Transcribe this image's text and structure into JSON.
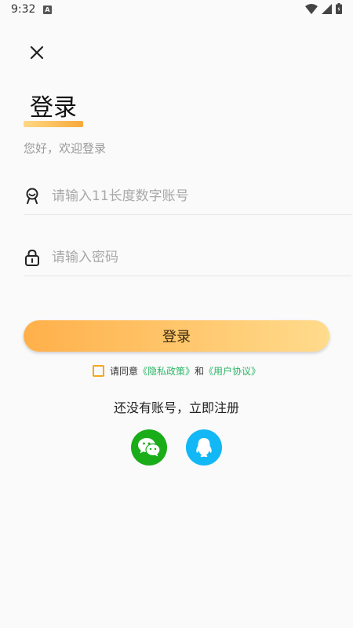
{
  "status_bar": {
    "time": "9:32",
    "notification_letter": "A",
    "icons": [
      "wifi-icon",
      "signal-icon",
      "battery-icon"
    ]
  },
  "header": {
    "close_icon": "close-icon"
  },
  "title": "登录",
  "subtitle": "您好，欢迎登录",
  "form": {
    "account": {
      "icon": "user-icon",
      "value": "",
      "placeholder": "请输入11长度数字账号"
    },
    "password": {
      "icon": "lock-icon",
      "value": "",
      "placeholder": "请输入密码"
    }
  },
  "login_button": "登录",
  "agreement": {
    "prefix": "请同意",
    "privacy": "《隐私政策》",
    "and": "和",
    "terms": "《用户协议》",
    "checked": false
  },
  "register_text": "还没有账号，立即注册",
  "social": [
    {
      "name": "wechat",
      "icon": "wechat-icon",
      "color": "#1aad19"
    },
    {
      "name": "qq",
      "icon": "qq-icon",
      "color": "#12b7f5"
    }
  ],
  "colors": {
    "accent_start": "#ffb04a",
    "accent_end": "#ffdb8c",
    "link": "#2bb566",
    "checkbox": "#f5a623"
  }
}
